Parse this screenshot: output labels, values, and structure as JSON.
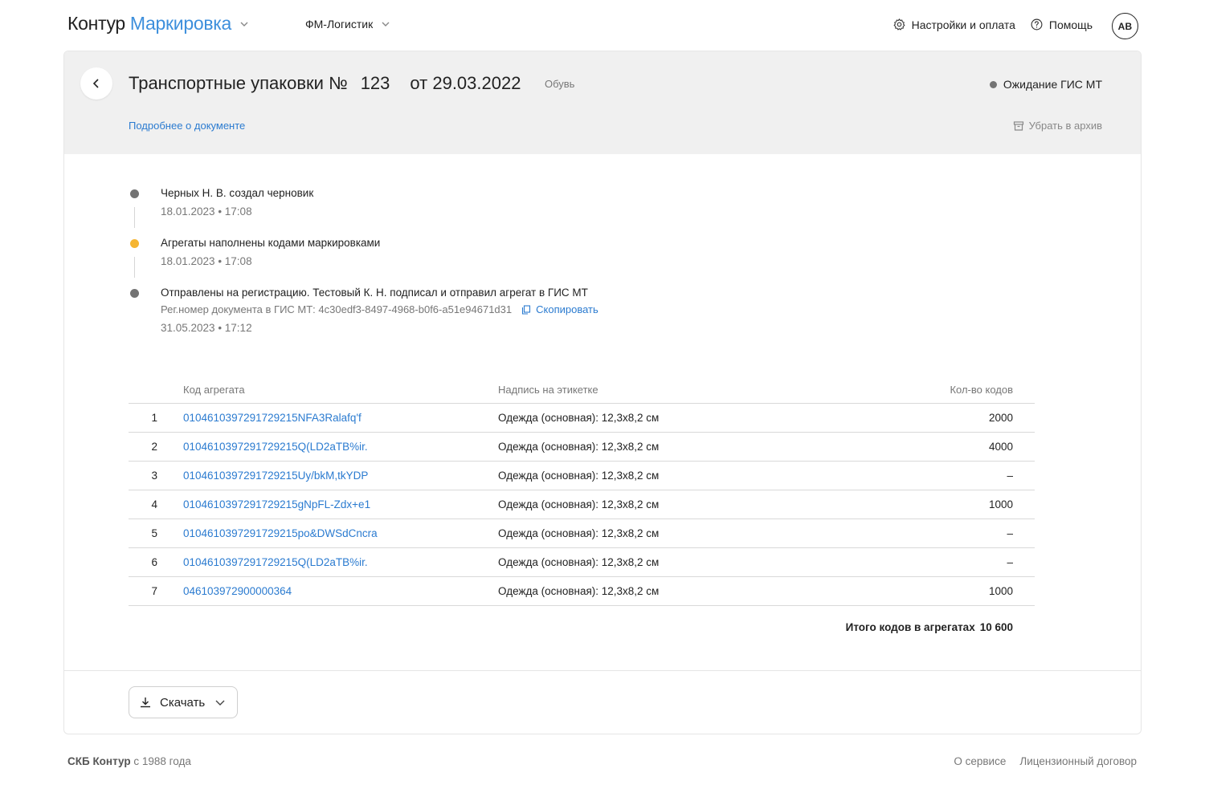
{
  "header": {
    "brand": "Контур",
    "product": "Маркировка",
    "organization": "ФМ-Логистик",
    "settings_label": "Настройки и оплата",
    "help_label": "Помощь",
    "avatar_initials": "АВ"
  },
  "document": {
    "title": "Транспортные упаковки №",
    "number": "123",
    "date": "от 29.03.2022",
    "category": "Обувь",
    "status": "Ожидание ГИС МТ",
    "status_color": "#737373",
    "more_link": "Подробнее о документе",
    "archive_label": "Убрать в архив"
  },
  "timeline": [
    {
      "text": "Черных Н. В. создал черновик",
      "time": "18.01.2023 • 17:08",
      "dot_color": "#737373"
    },
    {
      "text": "Агрегаты наполнены кодами маркировками",
      "time": "18.01.2023 • 17:08",
      "dot_color": "#f5b532"
    },
    {
      "text": "Отправлены на регистрацию. Тестовый К. Н. подписал и отправил агрегат в ГИС МТ",
      "sub": "Рег.номер документа в ГИС МТ: 4c30edf3-8497-4968-b0f6-a51e94671d31",
      "copy_label": "Скопировать",
      "time": "31.05.2023 • 17:12",
      "dot_color": "#737373"
    }
  ],
  "table": {
    "headers": {
      "code": "Код агрегата",
      "label": "Надпись на этикетке",
      "qty": "Кол-во кодов"
    },
    "rows": [
      {
        "num": "1",
        "code": "0104610397291729215NFA3Ralafq'f",
        "label": "Одежда (основная): 12,3х8,2 см",
        "qty": "2000"
      },
      {
        "num": "2",
        "code": "0104610397291729215Q(LD2aTB%ir.",
        "label": "Одежда (основная): 12,3х8,2 см",
        "qty": "4000"
      },
      {
        "num": "3",
        "code": "0104610397291729215Uy/bkM,tkYDP",
        "label": "Одежда (основная): 12,3х8,2 см",
        "qty": "–"
      },
      {
        "num": "4",
        "code": "0104610397291729215gNpFL-Zdx+e1",
        "label": "Одежда (основная): 12,3х8,2 см",
        "qty": "1000"
      },
      {
        "num": "5",
        "code": "0104610397291729215po&DWSdCncra",
        "label": "Одежда (основная): 12,3х8,2 см",
        "qty": "–"
      },
      {
        "num": "6",
        "code": "0104610397291729215Q(LD2aTB%ir.",
        "label": "Одежда (основная): 12,3х8,2 см",
        "qty": "–"
      },
      {
        "num": "7",
        "code": "046103972900000364",
        "label": "Одежда (основная): 12,3х8,2 см",
        "qty": "1000"
      }
    ],
    "total_label": "Итого кодов в агрегатах",
    "total_value": "10 600"
  },
  "actions": {
    "download_label": "Скачать"
  },
  "footer": {
    "company": "СКБ Контур",
    "since": "с 1988 года",
    "about": "О сервисе",
    "license": "Лицензионный договор"
  },
  "colors": {
    "accent": "#2b7bd0",
    "brand_blue": "#3d8fdc",
    "header_bg": "#f0f0f0"
  }
}
